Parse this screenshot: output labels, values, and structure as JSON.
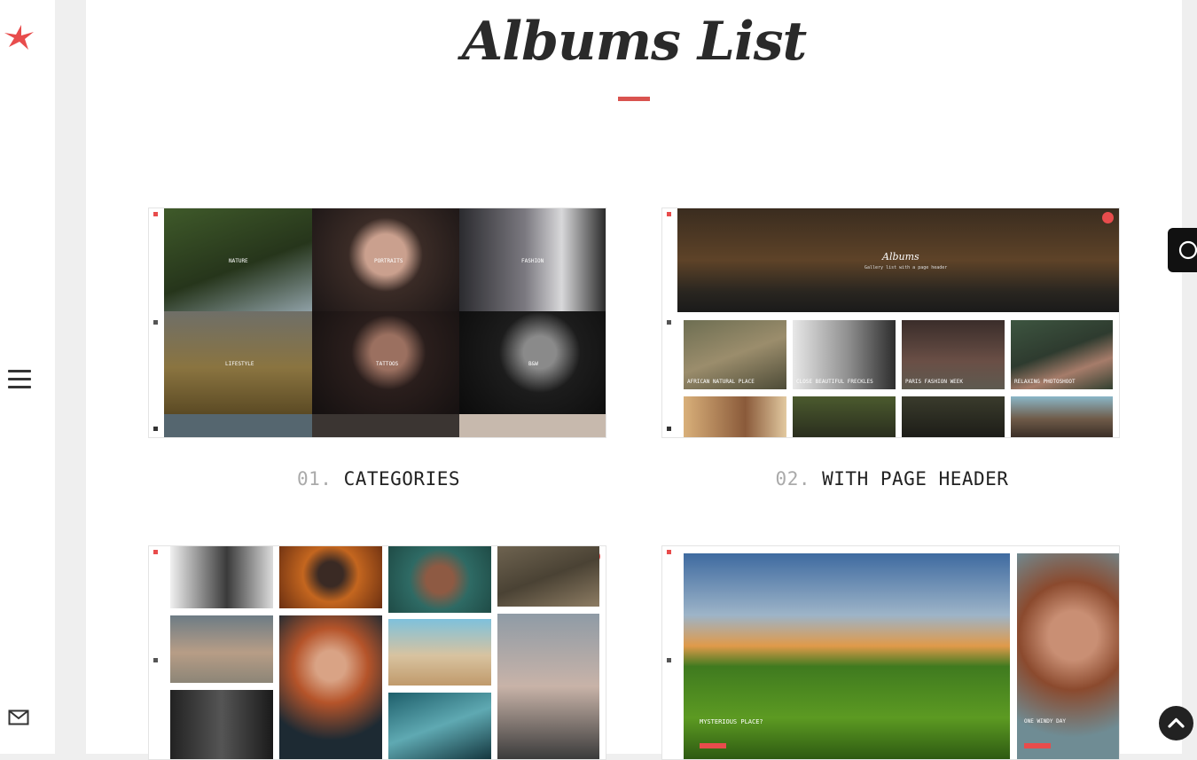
{
  "page": {
    "title": "Albums List",
    "accent_color": "#d9534f"
  },
  "sidebar": {
    "logo_icon": "bird-logo-icon",
    "menu_icon": "hamburger-menu-icon",
    "mail_icon": "envelope-icon"
  },
  "albums": [
    {
      "number": "01.",
      "label": "CATEGORIES"
    },
    {
      "number": "02.",
      "label": "WITH PAGE HEADER"
    }
  ],
  "thumb1": {
    "tiles": [
      "Nature",
      "Portraits",
      "Fashion",
      "Lifestyle",
      "Tattoos",
      "B&W"
    ]
  },
  "thumb2": {
    "header_title": "Albums",
    "header_subtitle": "Gallery list with a page header",
    "tiles": [
      "African Natural Place",
      "Close Beautiful Freckles",
      "Paris Fashion Week",
      "Relaxing Photoshoot"
    ]
  },
  "thumb4": {
    "caption_main": "Mysterious Place?",
    "caption_side": "One Windy Day"
  },
  "widgets": {
    "theme_toggle_icon": "moon-icon",
    "scroll_top_icon": "chevron-up-icon"
  }
}
